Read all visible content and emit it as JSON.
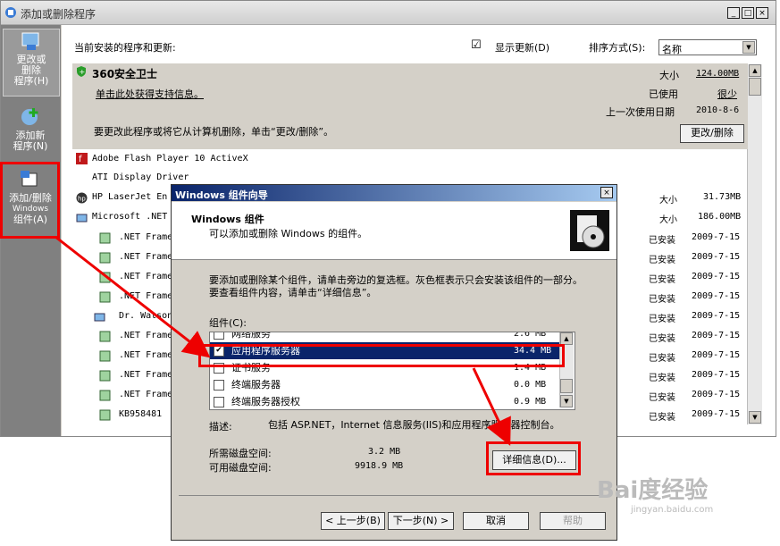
{
  "window": {
    "title": "添加或删除程序",
    "min": "_",
    "max": "□",
    "close": "×"
  },
  "sidebar": {
    "items": [
      {
        "label_lines": [
          "更改或",
          "删除",
          "程序(H)"
        ]
      },
      {
        "label_lines": [
          "添加新",
          "程序(N)"
        ]
      },
      {
        "label_lines": [
          "添加/删除",
          "Windows",
          "组件(A)"
        ]
      }
    ]
  },
  "header": {
    "current_label": "当前安装的程序和更新:",
    "show_updates_check": "☑",
    "show_updates_label": "显示更新(D)",
    "sort_label": "排序方式(S):",
    "sort_value": "名称"
  },
  "selected_program": {
    "name": "360安全卫士",
    "support_link": "单击此处获得支持信息。",
    "note": "要更改此程序或将它从计算机删除，单击“更改/删除”。",
    "size_label": "大小",
    "size_value": "124.00MB",
    "used_label": "已使用",
    "used_value": "很少",
    "last_used_label": "上一次使用日期",
    "last_used_value": "2010-8-6",
    "change_button": "更改/删除"
  },
  "programs": [
    {
      "name": "Adobe Flash Player 10 ActiveX",
      "label": "",
      "value": ""
    },
    {
      "name": "ATI Display Driver",
      "label": "",
      "value": ""
    },
    {
      "name": "HP LaserJet En",
      "label": "大小",
      "value": "31.73MB"
    },
    {
      "name": "Microsoft .NET",
      "label": "大小",
      "value": "186.00MB"
    },
    {
      "name": ".NET Frame",
      "label": "已安装",
      "value": "2009-7-15"
    },
    {
      "name": ".NET Frame",
      "label": "已安装",
      "value": "2009-7-15"
    },
    {
      "name": ".NET Frame",
      "label": "已安装",
      "value": "2009-7-15"
    },
    {
      "name": ".NET Frame",
      "label": "已安装",
      "value": "2009-7-15"
    },
    {
      "name": "Dr. Watson",
      "label": "已安装",
      "value": "2009-7-15"
    },
    {
      "name": ".NET Frame",
      "label": "已安装",
      "value": "2009-7-15"
    },
    {
      "name": ".NET Frame",
      "label": "已安装",
      "value": "2009-7-15"
    },
    {
      "name": ".NET Frame",
      "label": "已安装",
      "value": "2009-7-15"
    },
    {
      "name": ".NET Frame",
      "label": "已安装",
      "value": "2009-7-15"
    },
    {
      "name": "KB958481",
      "label": "已安装",
      "value": "2009-7-15"
    }
  ],
  "wizard": {
    "title": "Windows 组件向导",
    "close": "×",
    "heading": "Windows 组件",
    "subheading": "可以添加或删除 Windows 的组件。",
    "instructions": "要添加或删除某个组件，请单击旁边的复选框。灰色框表示只会安装该组件的一部分。要查看组件内容，请单击“详细信息”。",
    "components_label": "组件(C):",
    "components": [
      {
        "check": "",
        "name": "网络服务",
        "size": "2.6 MB"
      },
      {
        "check": "✔",
        "name": "应用程序服务器",
        "size": "34.4 MB"
      },
      {
        "check": "",
        "name": "证书服务",
        "size": "1.4 MB"
      },
      {
        "check": "",
        "name": "终端服务器",
        "size": "0.0 MB"
      },
      {
        "check": "",
        "name": "终端服务器授权",
        "size": "0.9 MB"
      }
    ],
    "desc_label": "描述:",
    "desc_text": "包括 ASP.NET，Internet 信息服务(IIS)和应用程序服务器控制台。",
    "required_label": "所需磁盘空间:",
    "required_value": "3.2 MB",
    "available_label": "可用磁盘空间:",
    "available_value": "9918.9 MB",
    "details_button": "详细信息(D)...",
    "back_button": "< 上一步(B)",
    "next_button": "下一步(N) >",
    "cancel_button": "取消",
    "help_button": "帮助"
  },
  "watermark": {
    "brand": "Bai度经验",
    "url": "jingyan.baidu.com"
  },
  "colors": {
    "annotation_red": "#ee0000",
    "selection_blue": "#0a246a",
    "sidebar_gray": "#808080"
  }
}
